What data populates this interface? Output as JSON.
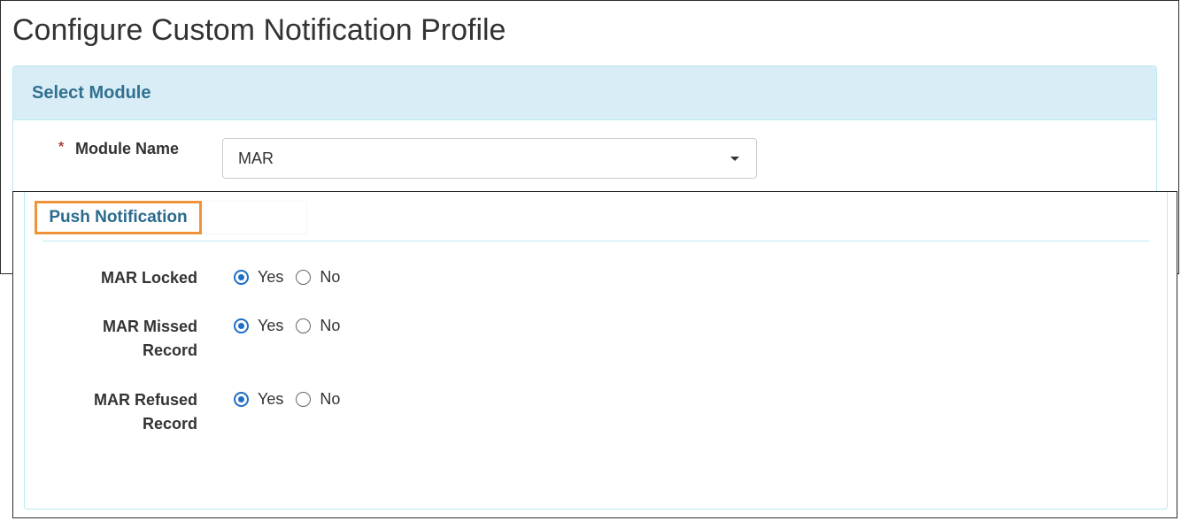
{
  "page": {
    "title": "Configure Custom Notification Profile"
  },
  "module_panel": {
    "heading": "Select Module",
    "required_marker": "*",
    "module_name_label": "Module Name",
    "module_name_value": "MAR"
  },
  "push_panel": {
    "tab_label": "Push Notification",
    "rows": [
      {
        "label_line1": "MAR Locked",
        "label_line2": "",
        "selected": "Yes"
      },
      {
        "label_line1": "MAR Missed",
        "label_line2": "Record",
        "selected": "Yes"
      },
      {
        "label_line1": "MAR Refused",
        "label_line2": "Record",
        "selected": "Yes"
      }
    ],
    "option_yes": "Yes",
    "option_no": "No"
  },
  "colors": {
    "panel_heading_bg": "#d9edf7",
    "panel_heading_text": "#31708f",
    "panel_border": "#bce8f1",
    "tab_highlight": "#f0923a",
    "radio_checked": "#1f6fc6",
    "required_star": "#a94442"
  }
}
